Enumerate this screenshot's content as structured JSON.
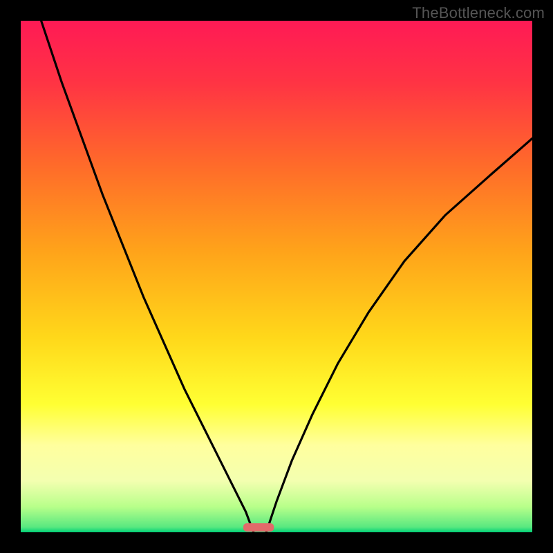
{
  "watermark": "TheBottleneck.com",
  "chart_data": {
    "type": "line",
    "title": "",
    "xlabel": "",
    "ylabel": "",
    "xlim": [
      0,
      100
    ],
    "ylim": [
      0,
      100
    ],
    "grid": false,
    "legend": false,
    "background": {
      "type": "vertical-gradient",
      "description": "Color gradient from red/pink at top through orange and yellow to green at bottom",
      "stops": [
        {
          "pos": 0,
          "color": "#ff1a55"
        },
        {
          "pos": 12,
          "color": "#ff3344"
        },
        {
          "pos": 28,
          "color": "#ff6a2a"
        },
        {
          "pos": 45,
          "color": "#ffa31a"
        },
        {
          "pos": 62,
          "color": "#ffd81a"
        },
        {
          "pos": 75,
          "color": "#ffff33"
        },
        {
          "pos": 83,
          "color": "#ffff9e"
        },
        {
          "pos": 90,
          "color": "#f3ffb0"
        },
        {
          "pos": 95,
          "color": "#b8ff8a"
        },
        {
          "pos": 99,
          "color": "#58e880"
        },
        {
          "pos": 100,
          "color": "#00d077"
        }
      ]
    },
    "series": [
      {
        "name": "left-curve",
        "description": "Descending curve from top-left to a minimum near x≈45",
        "x": [
          4,
          8,
          12,
          16,
          20,
          24,
          28,
          32,
          36,
          40,
          44,
          45.5
        ],
        "y": [
          100,
          88,
          77,
          66,
          56,
          46,
          37,
          28,
          20,
          12,
          4,
          0
        ]
      },
      {
        "name": "right-curve",
        "description": "Ascending curve from minimum near x≈48 to upper-right",
        "x": [
          48,
          50,
          53,
          57,
          62,
          68,
          75,
          83,
          92,
          100
        ],
        "y": [
          0,
          6,
          14,
          23,
          33,
          43,
          53,
          62,
          70,
          77
        ]
      }
    ],
    "marker": {
      "description": "Small rounded pink bar at the bottom near the minimum",
      "x_center": 46.5,
      "width": 6,
      "color": "#e26a6a"
    }
  }
}
